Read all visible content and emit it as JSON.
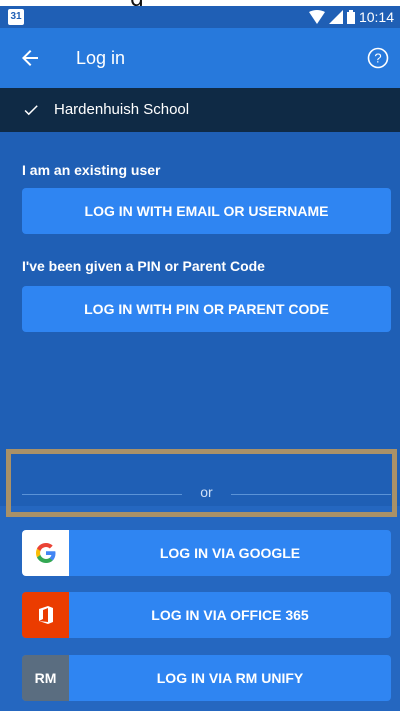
{
  "header_text": "g",
  "statusbar": {
    "calendar_day": "31",
    "time": "10:14"
  },
  "appbar": {
    "title": "Log in",
    "back_icon": "arrow-back-icon",
    "help_icon": "help-circle-icon"
  },
  "school": {
    "name": "Hardenhuish School",
    "check_icon": "check-icon"
  },
  "existing_user": {
    "label": "I am an existing user",
    "button_label": "LOG IN WITH EMAIL OR USERNAME"
  },
  "pin_user": {
    "label": "I've been given a PIN or Parent Code",
    "button_label": "LOG IN WITH PIN OR PARENT CODE"
  },
  "divider": {
    "text": "or"
  },
  "social": {
    "google": {
      "label": "LOG IN VIA GOOGLE",
      "icon": "google-icon"
    },
    "office365": {
      "label": "LOG IN VIA OFFICE 365",
      "icon": "office-365-icon"
    },
    "rm_unify": {
      "label": "LOG IN VIA RM UNIFY",
      "icon_text": "RM",
      "icon": "rm-unify-icon"
    }
  },
  "colors": {
    "primary": "#1f5fb5",
    "appbar": "#2779dc",
    "button": "#2f85f2",
    "school_bar": "#0f2a45",
    "highlight": "#a99168",
    "office_orange": "#eb3c00",
    "rm_gray": "#5a6d80"
  }
}
